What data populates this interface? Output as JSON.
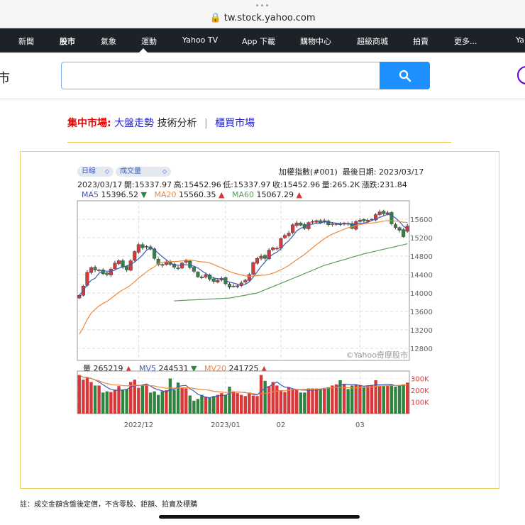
{
  "browser": {
    "url": "tw.stock.yahoo.com",
    "dots": "•••"
  },
  "nav": {
    "items": [
      "新聞",
      "股市",
      "氣象",
      "運動",
      "Yahoo TV",
      "App 下載",
      "購物中心",
      "超級商城",
      "拍賣",
      "更多...",
      "Ya"
    ],
    "active": "股市"
  },
  "header": {
    "brand": "市",
    "search_placeholder": ""
  },
  "links": {
    "market": "集中市場:",
    "trend": "大盤走勢",
    "tech": "技術分析",
    "sep": "|",
    "otc": "櫃買市場"
  },
  "chart_controls": {
    "period": "日線",
    "indicator": "成交量"
  },
  "info": {
    "title": "加權指數(#001)",
    "last_date_label": "最後日期: 2023/03/17",
    "ohlc": "2023/03/17  開:15337.97  高:15452.96  低:15337.97  收:15452.96  量:265.2K  漲跌:231.84"
  },
  "ma": {
    "ma5_label": "MA5",
    "ma5": "15396.52",
    "ma5_dir": "down",
    "ma20_label": "MA20",
    "ma20": "15560.35",
    "ma20_dir": "up",
    "ma60_label": "MA60",
    "ma60": "15067.29",
    "ma60_dir": "up"
  },
  "vol": {
    "label": "量",
    "value": "265219",
    "dir": "up",
    "mv5_label": "MV5",
    "mv5": "244531",
    "mv5_dir": "down",
    "mv20_label": "MV20",
    "mv20": "241725",
    "mv20_dir": "up"
  },
  "watermark": "©Yahoo奇摩股市",
  "colors": {
    "up": "#d9383a",
    "down": "#2e8540",
    "ma5": "#3f5bb5",
    "ma20": "#f0883a",
    "ma60": "#5a9e5f",
    "vol_axis": "#d9383a"
  },
  "note": "註：成交金額含盤後定價，不含零股、鉅額、拍賣及標購",
  "chart_data": {
    "type": "candlestick",
    "price_ticks": [
      15600,
      15200,
      14800,
      14400,
      14000,
      13600,
      13200,
      12800
    ],
    "price_range": [
      12600,
      15800
    ],
    "volume_ticks": [
      {
        "v": 300,
        "l": "300K"
      },
      {
        "v": 200,
        "l": "200K"
      },
      {
        "v": 100,
        "l": "100K"
      }
    ],
    "volume_range": [
      0,
      350
    ],
    "x_labels": [
      {
        "i": 15,
        "l": "2022/12"
      },
      {
        "i": 37,
        "l": "2023/01"
      },
      {
        "i": 51,
        "l": "02"
      },
      {
        "i": 71,
        "l": "03"
      }
    ],
    "close": [
      13950,
      14150,
      14450,
      14550,
      14500,
      14500,
      14420,
      14400,
      14520,
      14650,
      14700,
      14560,
      14500,
      14700,
      14900,
      15050,
      14980,
      15010,
      14950,
      14750,
      14620,
      14600,
      14680,
      14620,
      14560,
      14540,
      14650,
      14700,
      14550,
      14470,
      14350,
      14330,
      14400,
      14300,
      14250,
      14280,
      14320,
      14200,
      14130,
      14150,
      14160,
      14220,
      14280,
      14400,
      14660,
      14750,
      14800,
      14750,
      14930,
      14980,
      14970,
      15180,
      15250,
      15300,
      15480,
      15520,
      15470,
      15400,
      15530,
      15550,
      15570,
      15520,
      15570,
      15480,
      15500,
      15500,
      15480,
      15520,
      15500,
      15400,
      15550,
      15580,
      15560,
      15580,
      15600,
      15700,
      15760,
      15720,
      15740,
      15500,
      15420,
      15360,
      15221,
      15452.96
    ],
    "volume_k": [
      330,
      290,
      310,
      270,
      240,
      240,
      180,
      190,
      185,
      205,
      235,
      200,
      210,
      270,
      290,
      220,
      240,
      250,
      180,
      190,
      160,
      190,
      200,
      300,
      205,
      265,
      220,
      215,
      155,
      110,
      125,
      160,
      145,
      140,
      150,
      160,
      175,
      160,
      230,
      190,
      175,
      160,
      150,
      180,
      155,
      150,
      330,
      280,
      235,
      270,
      240,
      200,
      185,
      225,
      210,
      210,
      180,
      180,
      215,
      215,
      215,
      205,
      220,
      225,
      240,
      250,
      285,
      255,
      210,
      240,
      250,
      245,
      225,
      235,
      245,
      285,
      240,
      235,
      240,
      245,
      230,
      240,
      250,
      265
    ],
    "ma60_anchors": [
      [
        24,
        13830
      ],
      [
        38,
        13890
      ],
      [
        45,
        14000
      ],
      [
        55,
        14350
      ],
      [
        62,
        14600
      ],
      [
        72,
        14850
      ],
      [
        83,
        15067
      ]
    ]
  }
}
